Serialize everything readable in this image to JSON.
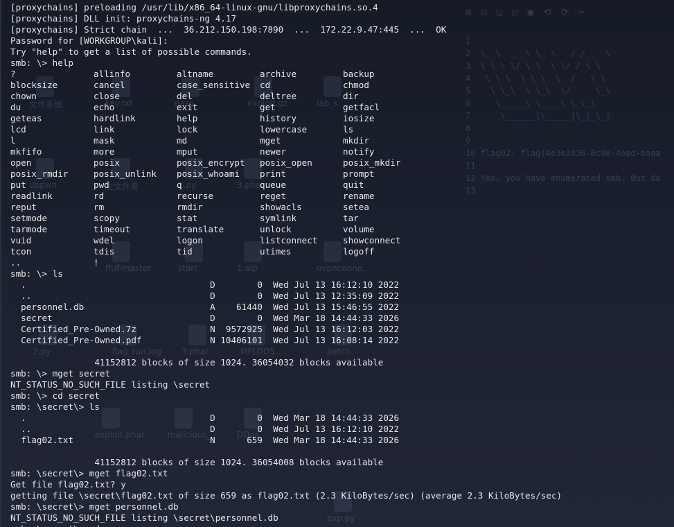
{
  "lines": [
    "[proxychains] preloading /usr/lib/x86_64-linux-gnu/libproxychains.so.4",
    "[proxychains] DLL init: proxychains-ng 4.17",
    "[proxychains] Strict chain  ...  36.212.150.198:7890  ...  172.22.9.47:445  ...  OK",
    "Password for [WORKGROUP\\kali]:",
    "Try \"help\" to get a list of possible commands.",
    "smb: \\> help"
  ],
  "help_grid": [
    [
      "?",
      "allinfo",
      "altname",
      "archive",
      "backup"
    ],
    [
      "blocksize",
      "cancel",
      "case_sensitive",
      "cd",
      "chmod"
    ],
    [
      "chown",
      "close",
      "del",
      "deltree",
      "dir"
    ],
    [
      "du",
      "echo",
      "exit",
      "get",
      "getfacl"
    ],
    [
      "geteas",
      "hardlink",
      "help",
      "history",
      "iosize"
    ],
    [
      "lcd",
      "link",
      "lock",
      "lowercase",
      "ls"
    ],
    [
      "l",
      "mask",
      "md",
      "mget",
      "mkdir"
    ],
    [
      "mkfifo",
      "more",
      "mput",
      "newer",
      "notify"
    ],
    [
      "open",
      "posix",
      "posix_encrypt",
      "posix_open",
      "posix_mkdir"
    ],
    [
      "posix_rmdir",
      "posix_unlink",
      "posix_whoami",
      "print",
      "prompt"
    ],
    [
      "put",
      "pwd",
      "q",
      "queue",
      "quit"
    ],
    [
      "readlink",
      "rd",
      "recurse",
      "reget",
      "rename"
    ],
    [
      "reput",
      "rm",
      "rmdir",
      "showacls",
      "setea"
    ],
    [
      "setmode",
      "scopy",
      "stat",
      "symlink",
      "tar"
    ],
    [
      "tarmode",
      "timeout",
      "translate",
      "unlock",
      "volume"
    ],
    [
      "vuid",
      "wdel",
      "logon",
      "listconnect",
      "showconnect"
    ],
    [
      "tcon",
      "tdis",
      "tid",
      "utimes",
      "logoff"
    ],
    [
      "..",
      "!",
      "",
      "",
      ""
    ]
  ],
  "after_help": [
    "smb: \\> ls",
    "  .                                   D        0  Wed Jul 13 16:12:10 2022",
    "  ..                                  D        0  Wed Jul 13 12:35:09 2022",
    "  personnel.db                        A    61440  Wed Jul 13 15:46:55 2022",
    "  secret                              D        0  Wed Mar 18 14:44:33 2026",
    "  Certified_Pre-Owned.7z              N  9572925  Wed Jul 13 16:12:03 2022",
    "  Certified_Pre-Owned.pdf             N 10406101  Wed Jul 13 16:08:14 2022",
    "",
    "                41152812 blocks of size 1024. 36054032 blocks available",
    "smb: \\> mget secret",
    "NT_STATUS_NO_SUCH_FILE listing \\secret",
    "smb: \\> cd secret",
    "smb: \\secret\\> ls",
    "  .                                   D        0  Wed Mar 18 14:44:33 2026",
    "  ..                                  D        0  Wed Jul 13 16:12:10 2022",
    "  flag02.txt                          N      659  Wed Mar 18 14:44:33 2026",
    "",
    "                41152812 blocks of size 1024. 36054008 blocks available",
    "smb: \\secret\\> mget flag02.txt",
    "Get file flag02.txt? y",
    "getting file \\secret\\flag02.txt of size 659 as flag02.txt (2.3 KiloBytes/sec) (average 2.3 KiloBytes/sec)",
    "smb: \\secret\\> mget personnel.db",
    "NT_STATUS_NO_SUCH_FILE listing \\secret\\personnel.db",
    "smb: \\secret\\> cd .."
  ],
  "background_editor": {
    "lines": [
      "1",
      "2  \\_ \\  ___\\ \\_ \\   / /__  \\",
      "3  \\ \\ \\ \\/ \\ \\  \\ \\/ / \\ \\",
      "4   \\ \\ \\  \\ \\ \\  \\  /   \\ \\",
      "5    \\ \\_\\  \\ \\_\\  \\/     \\_\\",
      "6     \\_____\\ \\____\\ \\_\\_\\",
      "7      \\______|\\_____|\\_|_\\_|",
      "8",
      "9",
      "10 flag02: flag{4e3e2a36-8c9e-4eed-baaa",
      "11",
      "12 Yes, you have enumerated smb. But do",
      "13"
    ]
  },
  "background_desktop": {
    "labels": [
      "文件系统",
      "key.txt",
      "easy",
      "exploit.gz",
      "lab_s",
      "ubpwn",
      "主文件夹",
      "1.py",
      "3.phar",
      "start",
      "1.aip",
      "ovpnconne...",
      "ffuf-master",
      "2.py",
      "flag_run.log",
      "3.phar",
      "MFLOO5...",
      "patch",
      "exploit.phar",
      "malicious_",
      "DDos",
      "exp.py"
    ]
  }
}
